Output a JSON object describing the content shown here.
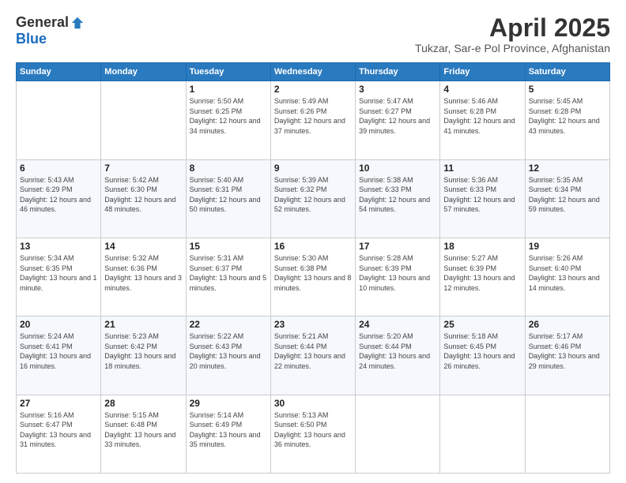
{
  "logo": {
    "general": "General",
    "blue": "Blue"
  },
  "title": {
    "month": "April 2025",
    "location": "Tukzar, Sar-e Pol Province, Afghanistan"
  },
  "headers": [
    "Sunday",
    "Monday",
    "Tuesday",
    "Wednesday",
    "Thursday",
    "Friday",
    "Saturday"
  ],
  "weeks": [
    [
      {
        "day": "",
        "info": ""
      },
      {
        "day": "",
        "info": ""
      },
      {
        "day": "1",
        "info": "Sunrise: 5:50 AM\nSunset: 6:25 PM\nDaylight: 12 hours and 34 minutes."
      },
      {
        "day": "2",
        "info": "Sunrise: 5:49 AM\nSunset: 6:26 PM\nDaylight: 12 hours and 37 minutes."
      },
      {
        "day": "3",
        "info": "Sunrise: 5:47 AM\nSunset: 6:27 PM\nDaylight: 12 hours and 39 minutes."
      },
      {
        "day": "4",
        "info": "Sunrise: 5:46 AM\nSunset: 6:28 PM\nDaylight: 12 hours and 41 minutes."
      },
      {
        "day": "5",
        "info": "Sunrise: 5:45 AM\nSunset: 6:28 PM\nDaylight: 12 hours and 43 minutes."
      }
    ],
    [
      {
        "day": "6",
        "info": "Sunrise: 5:43 AM\nSunset: 6:29 PM\nDaylight: 12 hours and 46 minutes."
      },
      {
        "day": "7",
        "info": "Sunrise: 5:42 AM\nSunset: 6:30 PM\nDaylight: 12 hours and 48 minutes."
      },
      {
        "day": "8",
        "info": "Sunrise: 5:40 AM\nSunset: 6:31 PM\nDaylight: 12 hours and 50 minutes."
      },
      {
        "day": "9",
        "info": "Sunrise: 5:39 AM\nSunset: 6:32 PM\nDaylight: 12 hours and 52 minutes."
      },
      {
        "day": "10",
        "info": "Sunrise: 5:38 AM\nSunset: 6:33 PM\nDaylight: 12 hours and 54 minutes."
      },
      {
        "day": "11",
        "info": "Sunrise: 5:36 AM\nSunset: 6:33 PM\nDaylight: 12 hours and 57 minutes."
      },
      {
        "day": "12",
        "info": "Sunrise: 5:35 AM\nSunset: 6:34 PM\nDaylight: 12 hours and 59 minutes."
      }
    ],
    [
      {
        "day": "13",
        "info": "Sunrise: 5:34 AM\nSunset: 6:35 PM\nDaylight: 13 hours and 1 minute."
      },
      {
        "day": "14",
        "info": "Sunrise: 5:32 AM\nSunset: 6:36 PM\nDaylight: 13 hours and 3 minutes."
      },
      {
        "day": "15",
        "info": "Sunrise: 5:31 AM\nSunset: 6:37 PM\nDaylight: 13 hours and 5 minutes."
      },
      {
        "day": "16",
        "info": "Sunrise: 5:30 AM\nSunset: 6:38 PM\nDaylight: 13 hours and 8 minutes."
      },
      {
        "day": "17",
        "info": "Sunrise: 5:28 AM\nSunset: 6:39 PM\nDaylight: 13 hours and 10 minutes."
      },
      {
        "day": "18",
        "info": "Sunrise: 5:27 AM\nSunset: 6:39 PM\nDaylight: 13 hours and 12 minutes."
      },
      {
        "day": "19",
        "info": "Sunrise: 5:26 AM\nSunset: 6:40 PM\nDaylight: 13 hours and 14 minutes."
      }
    ],
    [
      {
        "day": "20",
        "info": "Sunrise: 5:24 AM\nSunset: 6:41 PM\nDaylight: 13 hours and 16 minutes."
      },
      {
        "day": "21",
        "info": "Sunrise: 5:23 AM\nSunset: 6:42 PM\nDaylight: 13 hours and 18 minutes."
      },
      {
        "day": "22",
        "info": "Sunrise: 5:22 AM\nSunset: 6:43 PM\nDaylight: 13 hours and 20 minutes."
      },
      {
        "day": "23",
        "info": "Sunrise: 5:21 AM\nSunset: 6:44 PM\nDaylight: 13 hours and 22 minutes."
      },
      {
        "day": "24",
        "info": "Sunrise: 5:20 AM\nSunset: 6:44 PM\nDaylight: 13 hours and 24 minutes."
      },
      {
        "day": "25",
        "info": "Sunrise: 5:18 AM\nSunset: 6:45 PM\nDaylight: 13 hours and 26 minutes."
      },
      {
        "day": "26",
        "info": "Sunrise: 5:17 AM\nSunset: 6:46 PM\nDaylight: 13 hours and 29 minutes."
      }
    ],
    [
      {
        "day": "27",
        "info": "Sunrise: 5:16 AM\nSunset: 6:47 PM\nDaylight: 13 hours and 31 minutes."
      },
      {
        "day": "28",
        "info": "Sunrise: 5:15 AM\nSunset: 6:48 PM\nDaylight: 13 hours and 33 minutes."
      },
      {
        "day": "29",
        "info": "Sunrise: 5:14 AM\nSunset: 6:49 PM\nDaylight: 13 hours and 35 minutes."
      },
      {
        "day": "30",
        "info": "Sunrise: 5:13 AM\nSunset: 6:50 PM\nDaylight: 13 hours and 36 minutes."
      },
      {
        "day": "",
        "info": ""
      },
      {
        "day": "",
        "info": ""
      },
      {
        "day": "",
        "info": ""
      }
    ]
  ]
}
